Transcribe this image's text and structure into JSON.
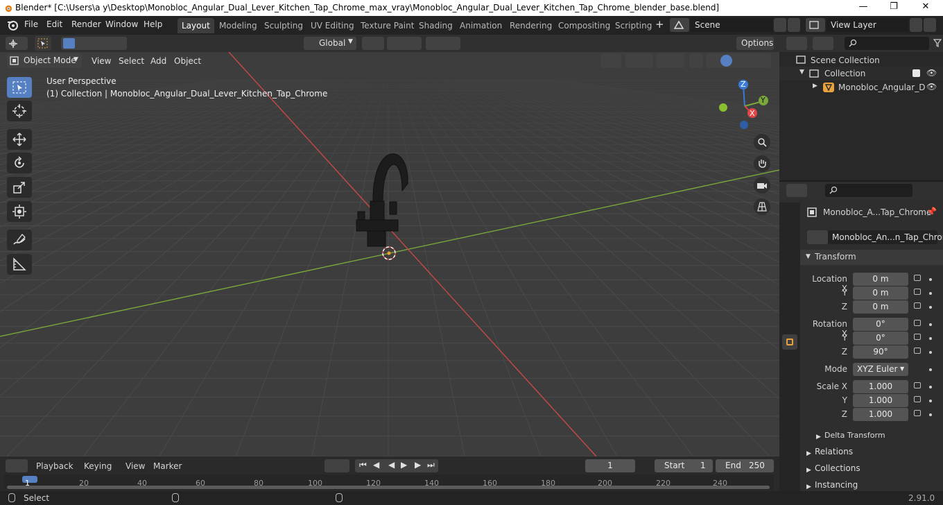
{
  "window": {
    "title": "Blender* [C:\\Users\\a y\\Desktop\\Monobloc_Angular_Dual_Lever_Kitchen_Tap_Chrome_max_vray\\Monobloc_Angular_Dual_Lever_Kitchen_Tap_Chrome_blender_base.blend]"
  },
  "menus": [
    "File",
    "Edit",
    "Render",
    "Window",
    "Help"
  ],
  "workspaces": [
    "Layout",
    "Modeling",
    "Sculpting",
    "UV Editing",
    "Texture Paint",
    "Shading",
    "Animation",
    "Rendering",
    "Compositing",
    "Scripting"
  ],
  "scene": {
    "name": "Scene",
    "view_layer": "View Layer"
  },
  "toolbar": {
    "orientation": "Global",
    "options": "Options"
  },
  "viewport": {
    "mode": "Object Mode",
    "menus": [
      "View",
      "Select",
      "Add",
      "Object"
    ],
    "perspective": "User Perspective",
    "collection_info": "(1) Collection | Monobloc_Angular_Dual_Lever_Kitchen_Tap_Chrome",
    "gizmo": {
      "x": "X",
      "y": "Y",
      "z": "Z"
    }
  },
  "outliner": {
    "scene_collection": "Scene Collection",
    "collection": "Collection",
    "object": "Monobloc_Angular_D"
  },
  "properties": {
    "object_name": "Monobloc_A...Tap_Chrome",
    "data_name": "Monobloc_An...n_Tap_Chrome",
    "transform_label": "Transform",
    "location_x_label": "Location X",
    "location_x": "0 m",
    "location_y": "0 m",
    "location_z": "0 m",
    "rotation_x_label": "Rotation X",
    "rotation_x": "0°",
    "rotation_y": "0°",
    "rotation_z": "90°",
    "y_label": "Y",
    "z_label": "Z",
    "mode_label": "Mode",
    "mode_value": "XYZ Euler",
    "scale_x_label": "Scale X",
    "scale_x": "1.000",
    "scale_y": "1.000",
    "scale_z": "1.000",
    "delta_transform": "Delta Transform",
    "relations": "Relations",
    "collections": "Collections",
    "instancing": "Instancing"
  },
  "timeline": {
    "menus": [
      "Playback",
      "Keying",
      "View",
      "Marker"
    ],
    "current_frame": "1",
    "start_label": "Start",
    "start": "1",
    "end_label": "End",
    "end": "250",
    "ruler": [
      "1",
      "20",
      "40",
      "60",
      "80",
      "100",
      "120",
      "140",
      "160",
      "180",
      "200",
      "220",
      "240"
    ]
  },
  "status": {
    "select": "Select",
    "version": "2.91.0"
  },
  "colors": {
    "accent": "#5680c2",
    "x_axis": "#c84848",
    "y_axis": "#7aa83a",
    "z_axis": "#3b7bd8"
  }
}
